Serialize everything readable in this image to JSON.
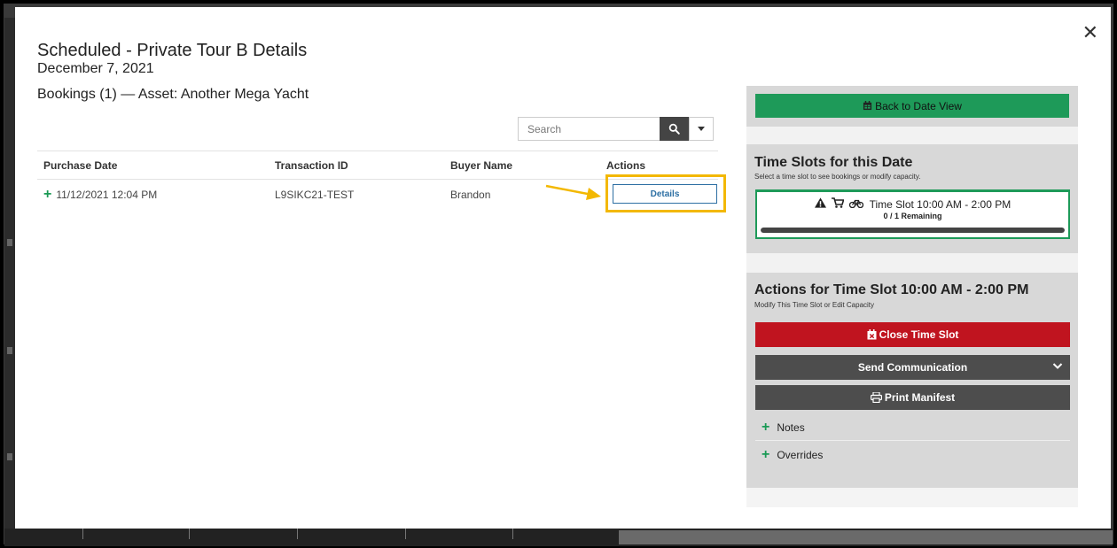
{
  "modal": {
    "title": "Scheduled - Private Tour B Details",
    "date": "December 7, 2021",
    "bookings_heading": "Bookings (1) — Asset: Another Mega Yacht",
    "close_glyph": "✕"
  },
  "search": {
    "placeholder": "Search",
    "icon": "search-icon",
    "dropdown_icon": "caret-down-icon"
  },
  "table": {
    "headers": [
      "Purchase Date",
      "Transaction ID",
      "Buyer Name",
      "Actions"
    ],
    "rows": [
      {
        "purchase_date": "11/12/2021 12:04 PM",
        "transaction_id": "L9SIKC21-TEST",
        "buyer_name": "Brandon",
        "action_label": "Details"
      }
    ]
  },
  "panel": {
    "back_label": "Back to Date View",
    "time_slots_title": "Time Slots for this Date",
    "time_slots_sub": "Select a time slot to see bookings or modify capacity.",
    "slot": {
      "label": "Time Slot 10:00 AM - 2:00 PM",
      "remaining": "0 / 1 Remaining",
      "icons": [
        "warning-icon",
        "cart-icon",
        "bike-icon"
      ],
      "fill_fraction": 1.0
    },
    "actions_title": "Actions for Time Slot 10:00 AM - 2:00 PM",
    "actions_sub": "Modify This Time Slot or Edit Capacity",
    "close_slot_label": "Close Time Slot",
    "send_comm_label": "Send Communication",
    "print_manifest_label": "Print Manifest",
    "notes_label": "Notes",
    "overrides_label": "Overrides"
  },
  "colors": {
    "green": "#1e9a59",
    "red": "#c0141f",
    "dark": "#4d4d4d",
    "highlight": "#f3b800",
    "link_blue": "#2d6fa3"
  }
}
